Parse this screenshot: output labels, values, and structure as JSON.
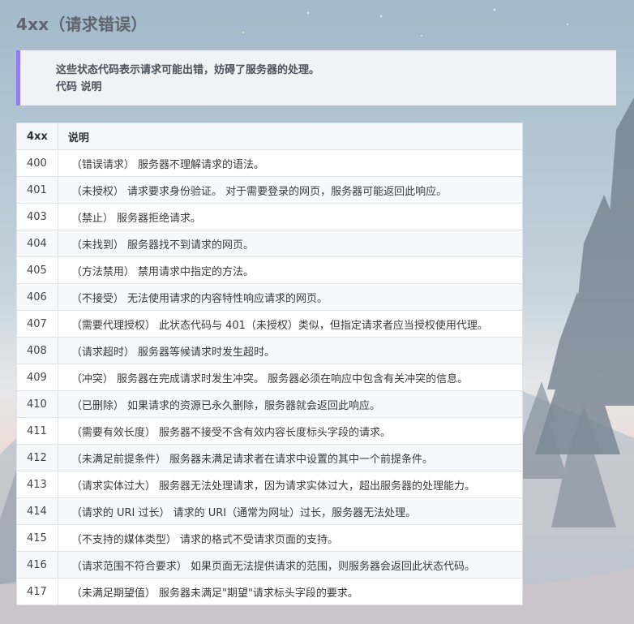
{
  "title": "4xx（请求错误）",
  "intro": {
    "line1": "这些状态代码表示请求可能出错，妨碍了服务器的处理。",
    "line2": "代码 说明"
  },
  "table": {
    "headers": [
      "4xx",
      "说明"
    ],
    "rows": [
      {
        "code": "400",
        "desc": "（错误请求） 服务器不理解请求的语法。"
      },
      {
        "code": "401",
        "desc": "（未授权） 请求要求身份验证。 对于需要登录的网页，服务器可能返回此响应。"
      },
      {
        "code": "403",
        "desc": "（禁止） 服务器拒绝请求。"
      },
      {
        "code": "404",
        "desc": "（未找到） 服务器找不到请求的网页。"
      },
      {
        "code": "405",
        "desc": "（方法禁用） 禁用请求中指定的方法。"
      },
      {
        "code": "406",
        "desc": "（不接受） 无法使用请求的内容特性响应请求的网页。"
      },
      {
        "code": "407",
        "desc": "（需要代理授权） 此状态代码与 401（未授权）类似，但指定请求者应当授权使用代理。"
      },
      {
        "code": "408",
        "desc": "（请求超时） 服务器等候请求时发生超时。"
      },
      {
        "code": "409",
        "desc": "（冲突） 服务器在完成请求时发生冲突。 服务器必须在响应中包含有关冲突的信息。"
      },
      {
        "code": "410",
        "desc": "（已删除） 如果请求的资源已永久删除，服务器就会返回此响应。"
      },
      {
        "code": "411",
        "desc": "（需要有效长度） 服务器不接受不含有效内容长度标头字段的请求。"
      },
      {
        "code": "412",
        "desc": "（未满足前提条件） 服务器未满足请求者在请求中设置的其中一个前提条件。"
      },
      {
        "code": "413",
        "desc": "（请求实体过大） 服务器无法处理请求，因为请求实体过大，超出服务器的处理能力。"
      },
      {
        "code": "414",
        "desc": "（请求的 URI 过长） 请求的 URI（通常为网址）过长，服务器无法处理。"
      },
      {
        "code": "415",
        "desc": "（不支持的媒体类型） 请求的格式不受请求页面的支持。"
      },
      {
        "code": "416",
        "desc": "（请求范围不符合要求） 如果页面无法提供请求的范围，则服务器会返回此状态代码。"
      },
      {
        "code": "417",
        "desc": "（未满足期望值） 服务器未满足\"期望\"请求标头字段的要求。"
      }
    ]
  },
  "colors": {
    "accent": "#8d7ff2",
    "title": "#5e6570"
  }
}
